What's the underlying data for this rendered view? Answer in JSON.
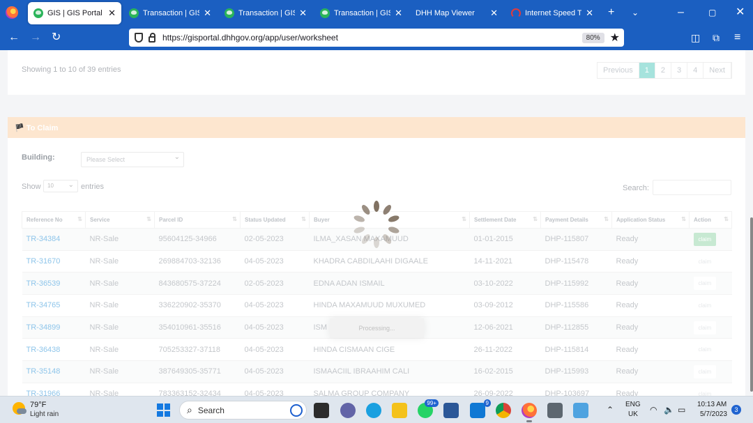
{
  "browser": {
    "tabs": [
      {
        "title": "GIS | GIS Portal",
        "favicon": "dhh-logo-icon",
        "active": true
      },
      {
        "title": "Transaction | GIS Po",
        "favicon": "dhh-logo-icon",
        "active": false
      },
      {
        "title": "Transaction | GIS Po",
        "favicon": "dhh-logo-icon",
        "active": false
      },
      {
        "title": "Transaction | GIS Po",
        "favicon": "dhh-logo-icon",
        "active": false
      },
      {
        "title": "DHH Map Viewer",
        "favicon": "none",
        "active": false
      },
      {
        "title": "Internet Speed Test |",
        "favicon": "speed-test-icon",
        "active": false
      }
    ],
    "url": "https://gisportal.dhhgov.org/app/user/worksheet",
    "zoom": "80%"
  },
  "top_card": {
    "showing": "Showing 1 to 10 of 39 entries",
    "pagination": {
      "previous": "Previous",
      "pages": [
        "1",
        "2",
        "3",
        "4"
      ],
      "current": "1",
      "next": "Next"
    }
  },
  "to_claim": {
    "header": "🏴 To Claim",
    "building_label": "Building:",
    "building_placeholder": "Please Select",
    "show_label": "Show",
    "page_length": "10",
    "entries_label": "entries",
    "search_label": "Search:",
    "columns": [
      "Reference No",
      "Service",
      "Parcel ID",
      "Status Updated",
      "Buyer",
      "Settlement Date",
      "Payment Details",
      "Application Status",
      "Action"
    ],
    "rows": [
      [
        "TR-34384",
        "NR-Sale",
        "95604125-34966",
        "02-05-2023",
        "ILMA_XASAN MAXAMUUD",
        "01-01-2015",
        "DHP-115807",
        "Ready",
        "claim"
      ],
      [
        "TR-31670",
        "NR-Sale",
        "269884703-32136",
        "04-05-2023",
        "KHADRA CABDILAAHI DIGAALE",
        "14-11-2021",
        "DHP-115478",
        "Ready",
        "claim"
      ],
      [
        "TR-36539",
        "NR-Sale",
        "843680575-37224",
        "02-05-2023",
        "EDNA ADAN ISMAIL",
        "03-10-2022",
        "DHP-115992",
        "Ready",
        "claim"
      ],
      [
        "TR-34765",
        "NR-Sale",
        "336220902-35370",
        "04-05-2023",
        "HINDA MAXAMUUD MUXUMED",
        "03-09-2012",
        "DHP-115586",
        "Ready",
        "claim"
      ],
      [
        "TR-34899",
        "NR-Sale",
        "354010961-35516",
        "04-05-2023",
        "ISM M",
        "12-06-2021",
        "DHP-112855",
        "Ready",
        "claim"
      ],
      [
        "TR-36438",
        "NR-Sale",
        "705253327-37118",
        "04-05-2023",
        "HINDA CISMAAN CIGE",
        "26-11-2022",
        "DHP-115814",
        "Ready",
        "claim"
      ],
      [
        "TR-35148",
        "NR-Sale",
        "387649305-35771",
        "04-05-2023",
        "ISMAACIIL IBRAAHIM CALI",
        "16-02-2015",
        "DHP-115993",
        "Ready",
        "claim"
      ],
      [
        "TR-31966",
        "NR-Sale",
        "783363152-32434",
        "04-05-2023",
        "SALMA GROUP COMPANY",
        "26-09-2022",
        "DHP-103697",
        "Ready",
        "claim"
      ]
    ],
    "processing": "Processing..."
  },
  "taskbar": {
    "temperature": "79°F",
    "weather": "Light rain",
    "search_label": "Search",
    "whatsapp_badge": "99+",
    "mail_badge": "9",
    "lang_top": "ENG",
    "lang_bottom": "UK",
    "time": "10:13 AM",
    "date": "5/7/2023",
    "notifications": "3"
  },
  "colors": {
    "chrome_blue": "#1b5fc1",
    "claim_header": "#fde6cf",
    "link": "#8ec5ea",
    "claim_button": "#c7e9d2"
  }
}
